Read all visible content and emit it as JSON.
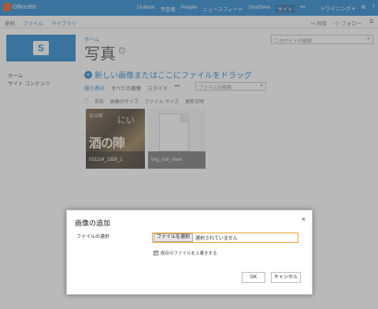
{
  "suite": {
    "brand": "Office365",
    "nav": [
      "Outlook",
      "予定表",
      "People",
      "ニュースフィード",
      "OneDrive",
      "サイト",
      "•••"
    ],
    "active_index": 5,
    "user": "トワイニング ▾",
    "settings_icon": "⚙",
    "help_icon": "?"
  },
  "ribbon": {
    "browse": "参照",
    "tab_file": "ファイル",
    "tab_library": "ライブラリ",
    "share": "共有",
    "follow": "フォロー",
    "focus_icon": "⧉"
  },
  "site": {
    "crumb": "ホーム",
    "title": "写真",
    "search_placeholder": "このサイトの検索"
  },
  "leftnav": [
    "ホーム",
    "サイト コンテンツ"
  ],
  "library": {
    "new_label": "新しい画像またはここにファイルをドラッグ",
    "views": [
      "縮小表示",
      "すべての画像",
      "スライド",
      "•••"
    ],
    "file_search_placeholder": "ファイルの検索",
    "columns": [
      "名前",
      "画像のサイズ",
      "ファイル サイズ",
      "更新日時"
    ],
    "items": [
      {
        "caption": "031114_1358_1",
        "thumb_text_1": "にい",
        "thumb_text_2": "酒の陣",
        "thumb_text_3": "日は新"
      },
      {
        "caption": "img_non_town"
      }
    ]
  },
  "dialog": {
    "title": "画像の追加",
    "close": "×",
    "file_label": "ファイルの選択",
    "choose_button": "ファイルを選択",
    "no_file": "選択されていません",
    "overwrite_label": "既存のファイルを上書きする",
    "overwrite_checked": "✔",
    "ok": "OK",
    "cancel": "キャンセル"
  }
}
